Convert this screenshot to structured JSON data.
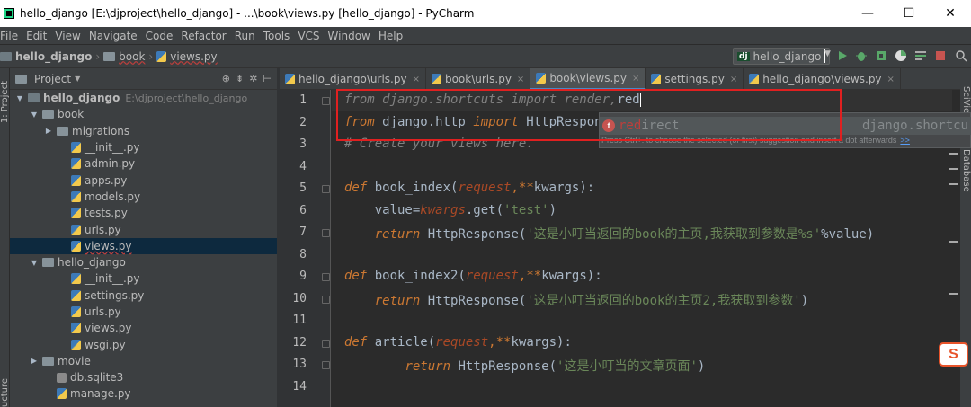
{
  "window": {
    "title": "hello_django [E:\\djproject\\hello_django] - ...\\book\\views.py [hello_django] - PyCharm",
    "minimize": "—",
    "maximize": "☐",
    "close": "✕"
  },
  "menu": [
    "File",
    "Edit",
    "View",
    "Navigate",
    "Code",
    "Refactor",
    "Run",
    "Tools",
    "VCS",
    "Window",
    "Help"
  ],
  "breadcrumbs": [
    "hello_django",
    "book",
    "views.py"
  ],
  "run_config": {
    "badge": "dj",
    "label": "hello_django"
  },
  "toolbar_icons": [
    "run-icon",
    "debug-icon",
    "coverage-icon",
    "profile-icon",
    "concurrency-icon",
    "stop-icon",
    "search-everywhere-icon"
  ],
  "left_strip": {
    "project": "1: Project",
    "structure": "ucture"
  },
  "right_strip": {
    "scview": "SciView",
    "database": "Database"
  },
  "project_panel": {
    "title": "Project",
    "tree": [
      {
        "label": "hello_django",
        "extra": "E:\\djproject\\hello_django",
        "indent": 0,
        "type": "root",
        "expanded": true
      },
      {
        "label": "book",
        "indent": 1,
        "type": "folder",
        "expanded": true
      },
      {
        "label": "migrations",
        "indent": 2,
        "type": "folder",
        "expanded": false
      },
      {
        "label": "__init__.py",
        "indent": 3,
        "type": "py"
      },
      {
        "label": "admin.py",
        "indent": 3,
        "type": "py"
      },
      {
        "label": "apps.py",
        "indent": 3,
        "type": "py"
      },
      {
        "label": "models.py",
        "indent": 3,
        "type": "py"
      },
      {
        "label": "tests.py",
        "indent": 3,
        "type": "py"
      },
      {
        "label": "urls.py",
        "indent": 3,
        "type": "py"
      },
      {
        "label": "views.py",
        "indent": 3,
        "type": "py",
        "selected": true
      },
      {
        "label": "hello_django",
        "indent": 1,
        "type": "folder",
        "expanded": true
      },
      {
        "label": "__init__.py",
        "indent": 3,
        "type": "py"
      },
      {
        "label": "settings.py",
        "indent": 3,
        "type": "py"
      },
      {
        "label": "urls.py",
        "indent": 3,
        "type": "py"
      },
      {
        "label": "views.py",
        "indent": 3,
        "type": "py"
      },
      {
        "label": "wsgi.py",
        "indent": 3,
        "type": "py"
      },
      {
        "label": "movie",
        "indent": 1,
        "type": "folder",
        "expanded": false
      },
      {
        "label": "db.sqlite3",
        "indent": 2,
        "type": "db"
      },
      {
        "label": "manage.py",
        "indent": 2,
        "type": "py"
      }
    ]
  },
  "tabs": [
    {
      "label": "hello_django\\urls.py",
      "active": false
    },
    {
      "label": "book\\urls.py",
      "active": false
    },
    {
      "label": "book\\views.py",
      "active": true
    },
    {
      "label": "settings.py",
      "active": false
    },
    {
      "label": "hello_django\\views.py",
      "active": false
    }
  ],
  "editor": {
    "line_numbers": [
      "1",
      "2",
      "3",
      "4",
      "5",
      "6",
      "7",
      "8",
      "9",
      "10",
      "11",
      "12",
      "13",
      "14"
    ],
    "lines": [
      [
        {
          "t": "from",
          "c": "cm"
        },
        {
          "t": " django.shortcuts ",
          "c": "cm"
        },
        {
          "t": "import",
          "c": "cm"
        },
        {
          "t": " render,",
          "c": "cm"
        },
        {
          "t": "red",
          "c": "plain"
        }
      ],
      [
        {
          "t": "from",
          "c": "kw"
        },
        {
          "t": " django.http ",
          "c": "plain"
        },
        {
          "t": "import",
          "c": "kw"
        },
        {
          "t": " HttpRespon",
          "c": "plain"
        }
      ],
      [
        {
          "t": "# Create your views here.",
          "c": "cm"
        }
      ],
      [],
      [
        {
          "t": "def",
          "c": "kw"
        },
        {
          "t": " ",
          "c": "plain"
        },
        {
          "t": "book_index",
          "c": "plain"
        },
        {
          "t": "(",
          "c": "plain"
        },
        {
          "t": "request",
          "c": "par"
        },
        {
          "t": ",",
          "c": "kwa"
        },
        {
          "t": "**",
          "c": "kwa"
        },
        {
          "t": "kwargs",
          "c": "plain"
        },
        {
          "t": "):",
          "c": "plain"
        }
      ],
      [
        {
          "t": "    value",
          "c": "plain"
        },
        {
          "t": "=",
          "c": "plain"
        },
        {
          "t": "kwargs",
          "c": "par"
        },
        {
          "t": ".get(",
          "c": "plain"
        },
        {
          "t": "'test'",
          "c": "str"
        },
        {
          "t": ")",
          "c": "plain"
        }
      ],
      [
        {
          "t": "    ",
          "c": "plain"
        },
        {
          "t": "return",
          "c": "kw"
        },
        {
          "t": " HttpResponse(",
          "c": "plain"
        },
        {
          "t": "'这是小叮当返回的book的主页,我获取到参数是%s'",
          "c": "str"
        },
        {
          "t": "%value)",
          "c": "plain"
        }
      ],
      [],
      [
        {
          "t": "def",
          "c": "kw"
        },
        {
          "t": " book_index2(",
          "c": "plain"
        },
        {
          "t": "request",
          "c": "par"
        },
        {
          "t": ",",
          "c": "kwa"
        },
        {
          "t": "**",
          "c": "kwa"
        },
        {
          "t": "kwargs):",
          "c": "plain"
        }
      ],
      [
        {
          "t": "    ",
          "c": "plain"
        },
        {
          "t": "return",
          "c": "kw"
        },
        {
          "t": " HttpResponse(",
          "c": "plain"
        },
        {
          "t": "'这是小叮当返回的book的主页2,我获取到参数'",
          "c": "str"
        },
        {
          "t": ")",
          "c": "plain"
        }
      ],
      [],
      [
        {
          "t": "def",
          "c": "kw"
        },
        {
          "t": " article(",
          "c": "plain"
        },
        {
          "t": "request",
          "c": "par"
        },
        {
          "t": ",",
          "c": "kwa"
        },
        {
          "t": "**",
          "c": "kwa"
        },
        {
          "t": "kwargs):",
          "c": "plain"
        }
      ],
      [
        {
          "t": "        ",
          "c": "plain"
        },
        {
          "t": "return",
          "c": "kw"
        },
        {
          "t": " HttpResponse(",
          "c": "plain"
        },
        {
          "t": "'这是小叮当的文章页面'",
          "c": "str"
        },
        {
          "t": ")",
          "c": "plain"
        }
      ],
      []
    ]
  },
  "completion": {
    "badge": "f",
    "match": "red",
    "rest": "irect",
    "module": "django.shortcu",
    "hint": "Press Ctrl+. to choose the selected (or first) suggestion and insert a dot afterwards",
    "hint_link": ">>"
  },
  "colors": {
    "accent": "#4a88c7",
    "highlight_box": "#e02020",
    "run": "#59a869",
    "stop": "#c75450"
  }
}
